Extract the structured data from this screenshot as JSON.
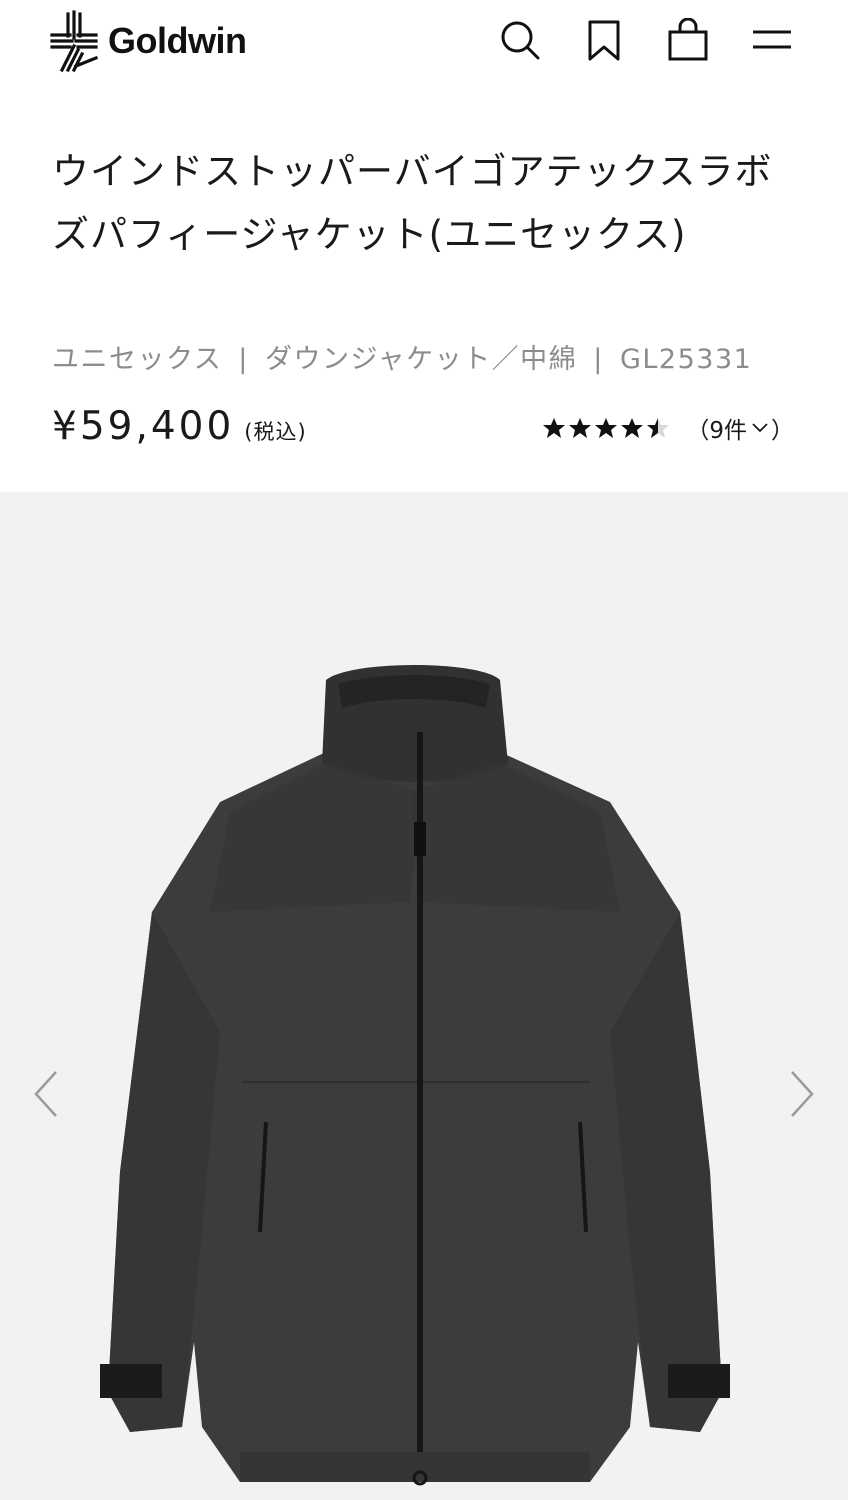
{
  "header": {
    "brand": "Goldwin",
    "icons": [
      "search-icon",
      "bookmark-icon",
      "shopping-bag-icon",
      "menu-icon"
    ]
  },
  "product": {
    "title": "ウインドストッパーバイゴアテックスラボズパフィージャケット(ユニセックス)",
    "gender": "ユニセックス",
    "category": "ダウンジャケット／中綿",
    "code": "GL25331",
    "separator": "|",
    "price": "¥59,400",
    "tax_label": "(税込)",
    "rating": 4.5,
    "review_count_label": "（9件",
    "review_close": "）"
  },
  "gallery": {
    "image_alt": "jacket-photo",
    "prev_icon": "chevron-left-icon",
    "next_icon": "chevron-right-icon"
  },
  "colors": {
    "gallery_bg": "#f2f2f2",
    "jacket": "#3a3d3c",
    "meta_text": "#8c8c8c"
  }
}
